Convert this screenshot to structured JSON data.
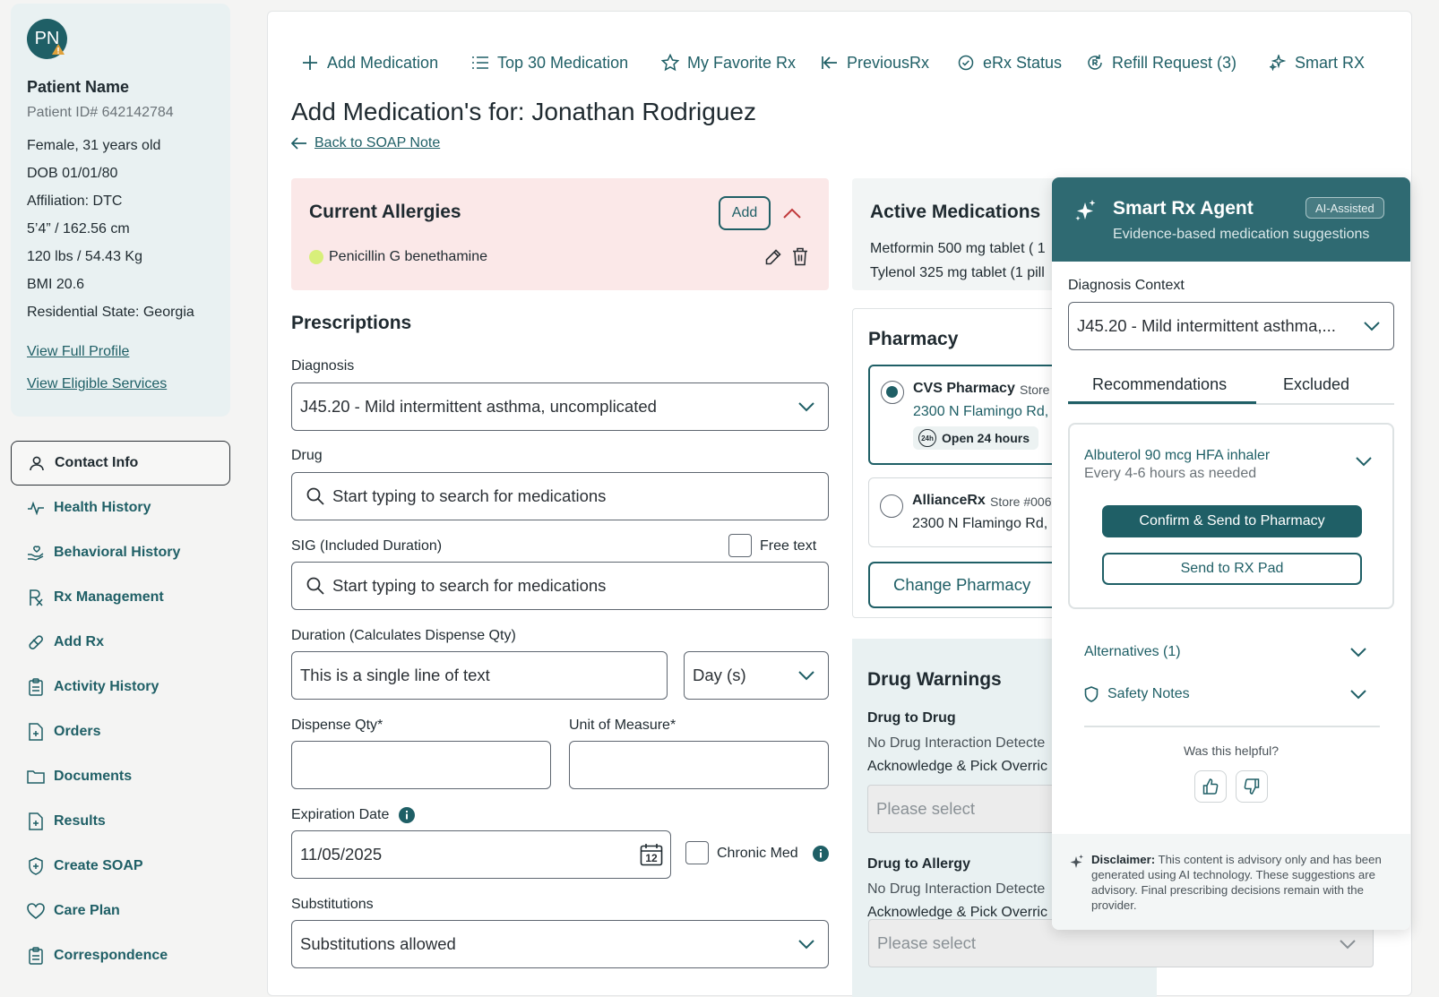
{
  "patient": {
    "initials": "PN",
    "name": "Patient Name",
    "id_label": "Patient ID# 642142784",
    "gender_age": "Female, 31 years old",
    "dob": "DOB 01/01/80",
    "affiliation": "Affiliation: DTC",
    "height": "5’4” / 162.56 cm",
    "weight": "120 lbs / 54.43 Kg",
    "bmi": "BMI 20.6",
    "state": "Residential State: Georgia",
    "view_profile": "View Full Profile",
    "view_services": "View Eligible Services"
  },
  "nav": {
    "contact": "Contact Info",
    "health": "Health History",
    "behavioral": "Behavioral History",
    "rx": "Rx Management",
    "addrx": "Add Rx",
    "activity": "Activity History",
    "orders": "Orders",
    "documents": "Documents",
    "results": "Results",
    "soap": "Create SOAP",
    "care": "Care Plan",
    "correspondence": "Correspondence"
  },
  "toolbar": {
    "add": "Add Medication",
    "top30": "Top 30 Medication",
    "favorite": "My Favorite Rx",
    "previous": "PreviousRx",
    "erx": "eRx Status",
    "refill": "Refill Request (3)",
    "smart": "Smart RX"
  },
  "page": {
    "title": "Add Medication's for: Jonathan Rodriguez",
    "back": "Back to SOAP Note"
  },
  "allergies": {
    "title": "Current Allergies",
    "add_label": "Add",
    "item": "Penicillin G benethamine"
  },
  "prescriptions": {
    "title": "Prescriptions",
    "diagnosis_label": "Diagnosis",
    "diagnosis_value": "J45.20 - Mild intermittent asthma, uncomplicated",
    "drug_label": "Drug",
    "drug_placeholder": "Start typing to search for medications",
    "sig_label": "SIG  (Included Duration)",
    "free_text": "Free text",
    "sig_placeholder": "Start typing to search for medications",
    "duration_label": "Duration (Calculates Dispense Qty)",
    "duration_value": "This is a single line of text",
    "duration_unit": "Day (s)",
    "dispense_label": "Dispense Qty*",
    "unit_label": "Unit of Measure*",
    "expiration_label": "Expiration Date",
    "expiration_value": "11/05/2025",
    "calendar_day": "12",
    "chronic": "Chronic Med",
    "substitutions_label": "Substitutions",
    "substitutions_value": "Substitutions allowed"
  },
  "active_meds": {
    "title": "Active Medications",
    "items": [
      "Metformin 500 mg tablet ( 1",
      "Tylenol 325 mg tablet (1 pill"
    ]
  },
  "pharmacy": {
    "title": "Pharmacy",
    "p1_name": "CVS Pharmacy",
    "p1_store": "Store",
    "p1_address": "2300 N Flamingo Rd,",
    "p1_hours_badge": "24h",
    "p1_hours": "Open 24 hours",
    "p2_name": "AllianceRx",
    "p2_store": "Store #006",
    "p2_address": "2300 N Flamingo Rd,",
    "change": "Change Pharmacy"
  },
  "warnings": {
    "title": "Drug Warnings",
    "d2d": "Drug to Drug",
    "d2d_text": "No Drug Interaction Detecte",
    "d2d_ack": "Acknowledge & Pick Overric",
    "d2d_select": "Please select",
    "d2a": "Drug to Allergy",
    "d2a_text": "No Drug Interaction Detecte",
    "d2a_ack": "Acknowledge & Pick Overric",
    "d2a_select": "Please select"
  },
  "smart_rx": {
    "title": "Smart Rx Agent",
    "badge": "AI-Assisted",
    "subtitle": "Evidence-based medication suggestions",
    "context_label": "Diagnosis Context",
    "context_value": "J45.20 - Mild intermittent asthma,...",
    "tab_recommendations": "Recommendations",
    "tab_excluded": "Excluded",
    "rec_name": "Albuterol 90 mcg HFA inhaler",
    "rec_freq": "Every 4-6 hours as needed",
    "confirm": "Confirm & Send to Pharmacy",
    "send_pad": "Send to RX Pad",
    "alternatives": "Alternatives (1)",
    "safety": "Safety Notes",
    "helpful": "Was this helpful?",
    "disclaimer_bold": "Disclaimer:",
    "disclaimer_text": " This content is advisory only and has been generated using AI technology. These suggestions are advisory. Final prescribing decisions remain with the provider."
  },
  "colors": {
    "brand": "#1f5f66",
    "header": "#2f6a72",
    "allergy_bg": "#fbe8e8",
    "allergy_dot": "#d8ef7a",
    "sidebar_card": "#e9f1f2"
  }
}
